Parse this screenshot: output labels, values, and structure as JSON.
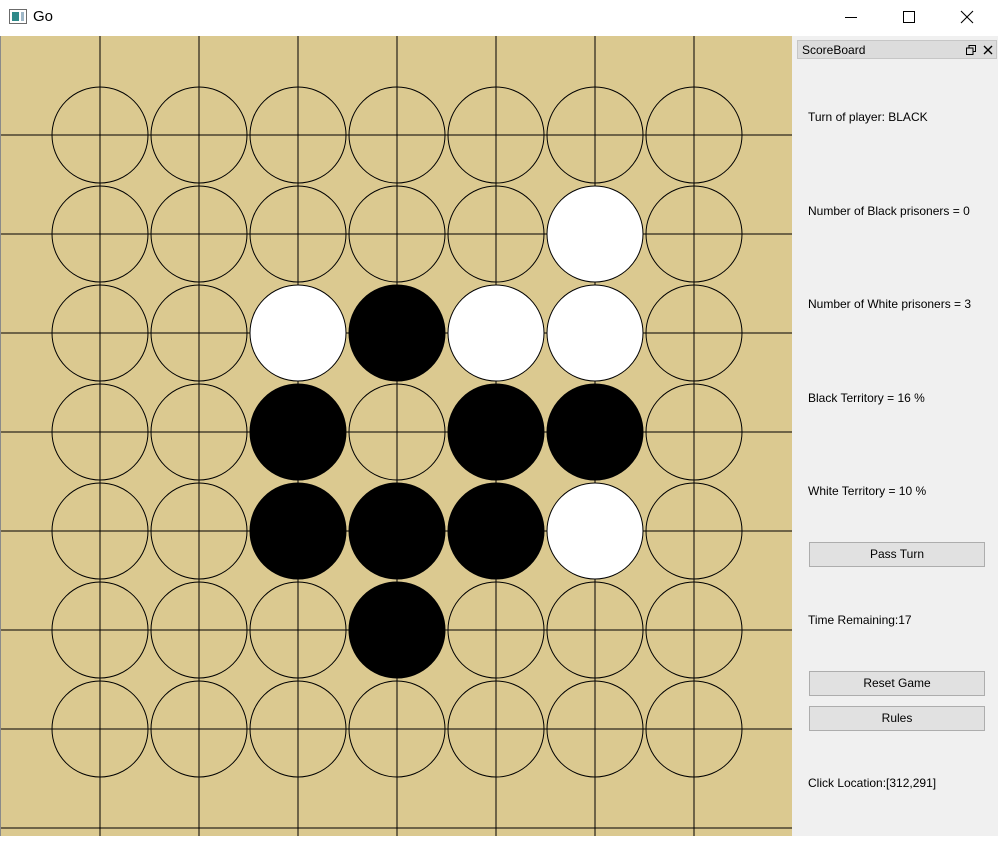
{
  "window": {
    "title": "Go",
    "controls": [
      "minimize-icon",
      "maximize-icon",
      "close-icon"
    ]
  },
  "board": {
    "size": 7,
    "colors": {
      "background": "#dbc990",
      "line": "#000000",
      "black": "#000000",
      "white": "#ffffff"
    },
    "stones": [
      [
        null,
        null,
        null,
        null,
        null,
        null,
        null
      ],
      [
        null,
        null,
        null,
        null,
        null,
        "white",
        null
      ],
      [
        null,
        null,
        "white",
        "black",
        "white",
        "white",
        null
      ],
      [
        null,
        null,
        "black",
        null,
        "black",
        "black",
        null
      ],
      [
        null,
        null,
        "black",
        "black",
        "black",
        "white",
        null
      ],
      [
        null,
        null,
        null,
        "black",
        null,
        null,
        null
      ],
      [
        null,
        null,
        null,
        null,
        null,
        null,
        null
      ]
    ]
  },
  "scoreboard": {
    "dock_title": "ScoreBoard",
    "turn": "Turn of player: BLACK",
    "black_prisoners": "Number of Black prisoners = 0",
    "white_prisoners": "Number of White prisoners = 3",
    "black_territory": "Black Territory = 16 %",
    "white_territory": "White Territory = 10 %",
    "pass_button": "Pass Turn",
    "time_remaining": "Time Remaining:17",
    "reset_button": "Reset Game",
    "rules_button": "Rules",
    "click_location": "Click Location:[312,291]"
  }
}
